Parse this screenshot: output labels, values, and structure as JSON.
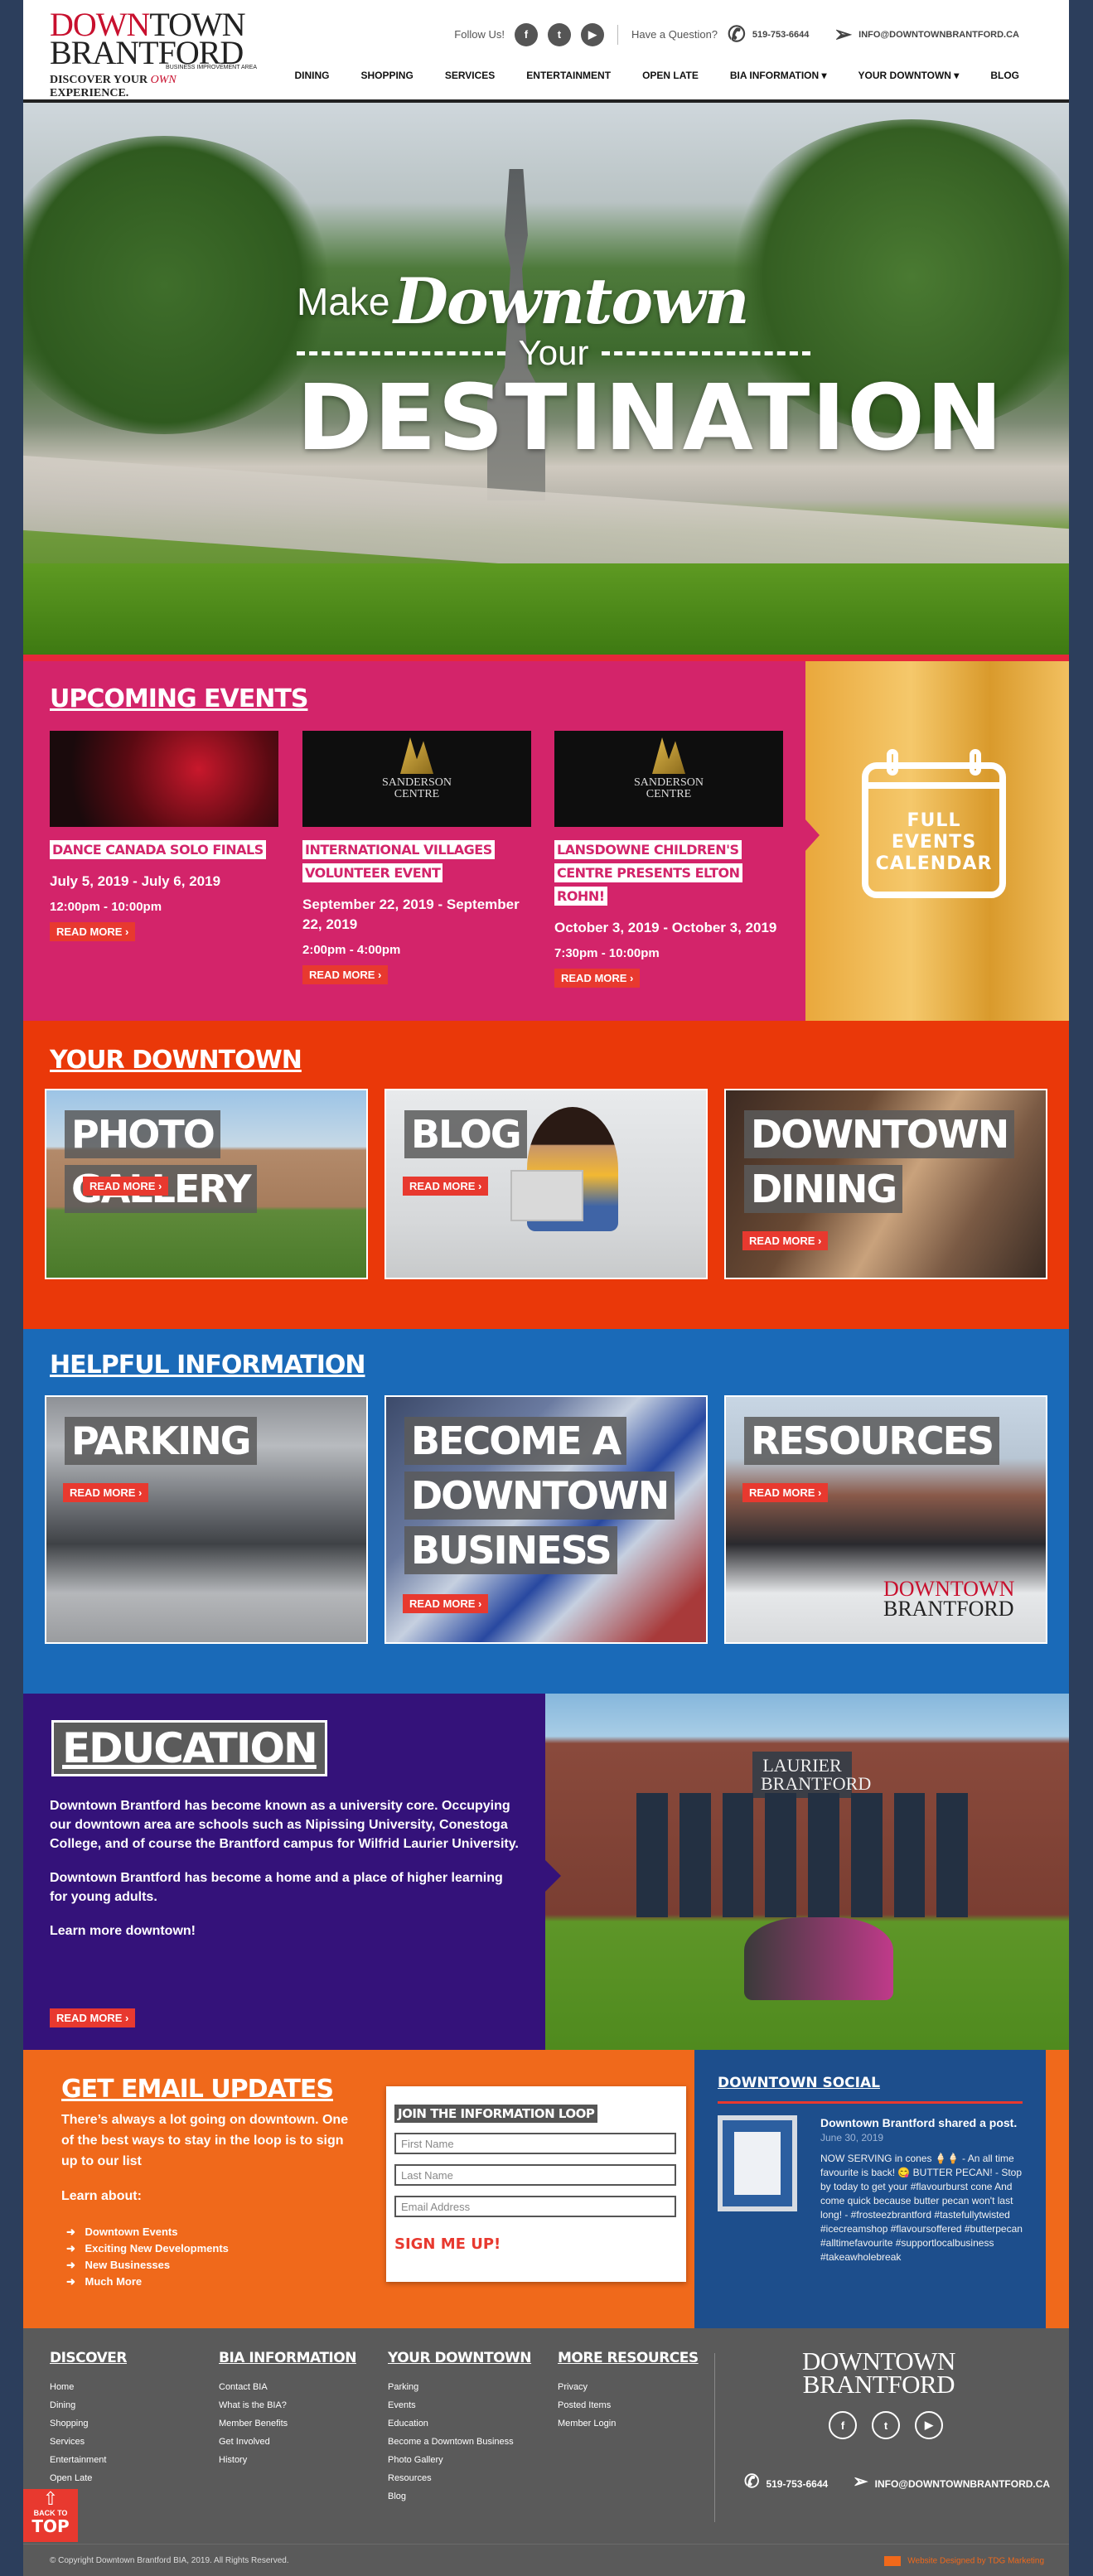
{
  "logo": {
    "line1_a": "DOWN",
    "line1_b": "TOWN",
    "line2": "BRANTFORD",
    "tag": "BUSINESS IMPROVEMENT AREA",
    "slogan_a": "DISCOVER YOUR ",
    "slogan_b": "OWN",
    "slogan_c": " EXPERIENCE."
  },
  "topbar": {
    "follow": "Follow Us!",
    "question": "Have a Question?",
    "phone": "519-753-6644",
    "email": "INFO@DOWNTOWNBRANTFORD.CA"
  },
  "social_icons": [
    "facebook-icon",
    "twitter-icon",
    "youtube-icon"
  ],
  "nav": [
    "DINING",
    "SHOPPING",
    "SERVICES",
    "ENTERTAINMENT",
    "OPEN LATE",
    "BIA INFORMATION ▾",
    "YOUR DOWNTOWN ▾",
    "BLOG"
  ],
  "hero": {
    "make": "Make",
    "downtown": "Downtown",
    "your": "Your",
    "destination": "DESTINATION"
  },
  "events": {
    "title": "UPCOMING EVENTS",
    "items": [
      {
        "name": "DANCE CANADA SOLO FINALS",
        "dates": "July 5, 2019 - July 6, 2019",
        "time": "12:00pm - 10:00pm",
        "read": "READ MORE ›",
        "img_color": "#1a0a0c"
      },
      {
        "name": "INTERNATIONAL VILLAGES VOLUNTEER EVENT",
        "dates": "September 22, 2019 - September 22, 2019",
        "time": "2:00pm - 4:00pm",
        "read": "READ MORE ›",
        "img_color": "#0e0e0e"
      },
      {
        "name": "LANSDOWNE CHILDREN'S CENTRE PRESENTS ELTON ROHN!",
        "dates": "October 3, 2019 - October 3, 2019",
        "time": "7:30pm - 10:00pm",
        "read": "READ MORE ›",
        "img_color": "#0e0e0e"
      }
    ],
    "calendar": "FULL EVENTS CALENDAR"
  },
  "your_downtown": {
    "title": "YOUR DOWNTOWN",
    "tiles": [
      {
        "label": "PHOTO GALLERY",
        "read": "READ MORE ›"
      },
      {
        "label": "BLOG",
        "read": "READ MORE ›"
      },
      {
        "label": "DOWNTOWN DINING",
        "read": "READ MORE ›"
      }
    ]
  },
  "helpful": {
    "title": "HELPFUL INFORMATION",
    "tiles": [
      {
        "label": "PARKING",
        "read": "READ MORE ›"
      },
      {
        "label": "BECOME A DOWNTOWN BUSINESS",
        "read": "READ MORE ›"
      },
      {
        "label": "RESOURCES",
        "read": "READ MORE ›"
      }
    ]
  },
  "education": {
    "title": "EDUCATION",
    "p1": "Downtown Brantford has become known as a university core. Occupying our downtown area are schools such as Nipissing University, Conestoga College, and of course the Brantford campus for Wilfrid Laurier University.",
    "p2": "Downtown Brantford has become a home and a place of higher learning for young adults.",
    "p3": "Learn more downtown!",
    "read": "READ MORE ›",
    "photo_sign": "LAURIER BRANTFORD"
  },
  "email": {
    "title": "GET EMAIL UPDATES",
    "intro": "There’s always a lot going on downtown. One of the best ways to stay in the loop is to sign up to our list",
    "learn": "Learn about:",
    "topics": [
      "Downtown Events",
      "Exciting New Developments",
      "New Businesses",
      "Much More"
    ],
    "form_title": "JOIN THE INFORMATION LOOP",
    "first": "First Name",
    "last": "Last Name",
    "emailph": "Email Address",
    "submit": "SIGN ME UP!"
  },
  "social": {
    "title": "DOWNTOWN SOCIAL",
    "name": "Downtown Brantford shared a post.",
    "date": "June 30, 2019",
    "text": "NOW SERVING in cones 🍦🍦 - An all time favourite is back! 😋 BUTTER PECAN! - Stop by today to get your #flavourburst cone And come quick because butter pecan won't last long! - #frosteezbrantford #tastefullytwisted #icecreamshop #flavoursoffered #butterpecan #alltimefavourite #supportlocalbusiness #takeawholebreak"
  },
  "footer": {
    "cols": [
      {
        "head": "DISCOVER",
        "links": [
          "Home",
          "Dining",
          "Shopping",
          "Services",
          "Entertainment",
          "Open Late"
        ]
      },
      {
        "head": "BIA INFORMATION",
        "links": [
          "Contact BIA",
          "What is the BIA?",
          "Member Benefits",
          "Get Involved",
          "History"
        ]
      },
      {
        "head": "YOUR DOWNTOWN",
        "links": [
          "Parking",
          "Events",
          "Education",
          "Become a Downtown Business",
          "Photo Gallery",
          "Resources",
          "Blog"
        ]
      },
      {
        "head": "MORE RESOURCES",
        "links": [
          "Privacy",
          "Posted Items",
          "Member Login"
        ]
      }
    ],
    "logo1": "DOWNTOWN",
    "logo2": "BRANTFORD",
    "phone": "519-753-6644",
    "email": "INFO@DOWNTOWNBRANTFORD.CA",
    "copyright": "© Copyright Downtown Brantford BIA, 2019. All Rights Reserved.",
    "designed": "Website Designed by TDG Marketing"
  },
  "totop": {
    "line1": "BACK TO",
    "line2": "TOP"
  }
}
